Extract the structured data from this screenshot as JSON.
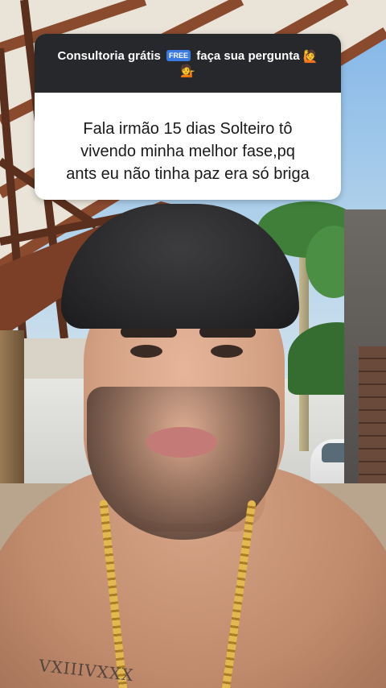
{
  "sticker": {
    "header_prefix": "Consultoria grátis",
    "free_badge": "FREE",
    "header_suffix": "faça sua pergunta",
    "emoji_raise": "🙋",
    "emoji_service": "💁",
    "question_line1": "Fala irmão 15 dias Solteiro tô",
    "question_line2": "vivendo minha melhor fase,pq",
    "question_line3": "ants eu não tinha paz era só briga"
  },
  "video": {
    "tattoo_text": "VXIIIVXXX"
  },
  "colors": {
    "sticker_header": "#27282b",
    "sticker_body": "#ffffff",
    "free_badge": "#3b7be0"
  }
}
